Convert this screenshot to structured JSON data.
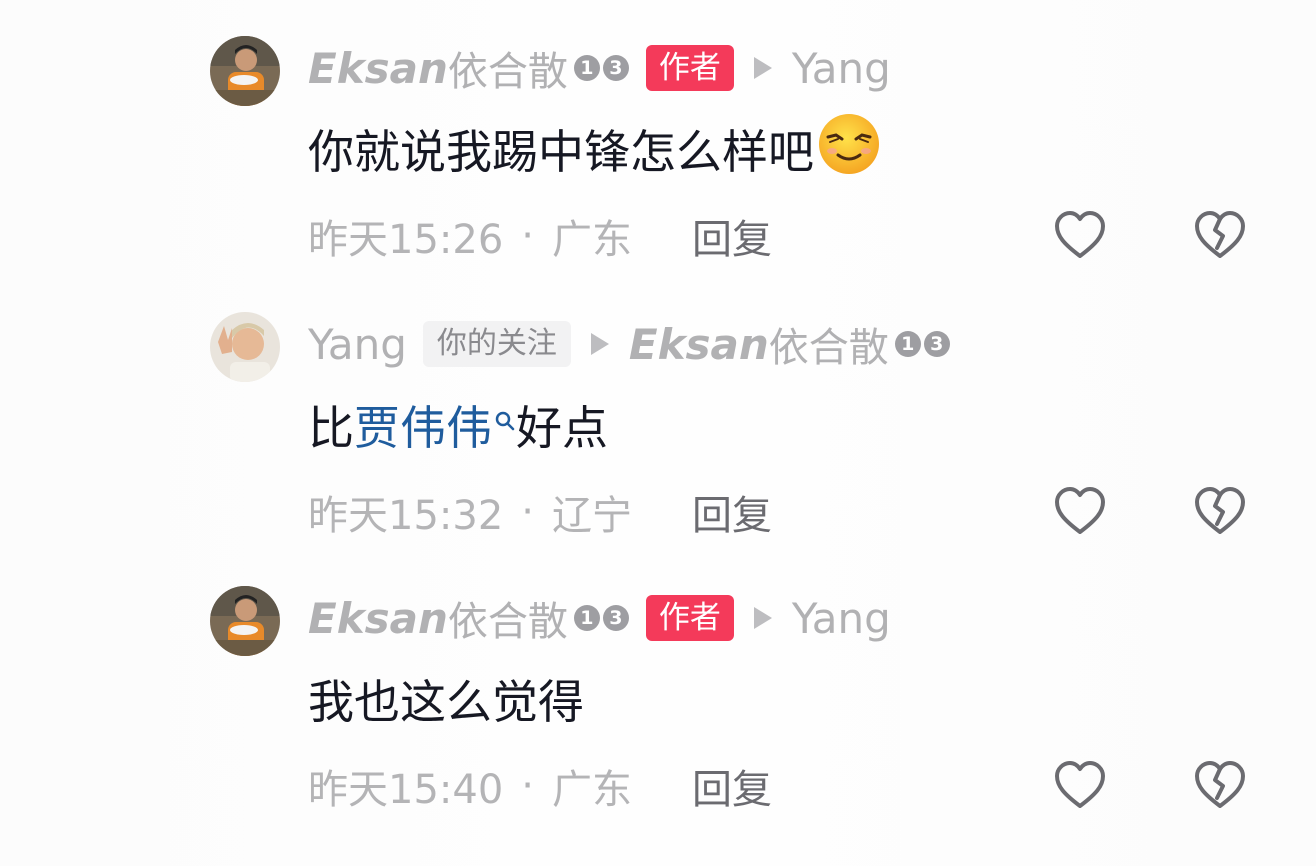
{
  "comments": [
    {
      "author_italic": "Eksan",
      "author_cn": "依合散",
      "level_digits": [
        "1",
        "3"
      ],
      "author_tag": "作者",
      "reply_to": "Yang",
      "text": "你就说我踢中锋怎么样吧",
      "emoji": "smiling-face-emoji",
      "time": "昨天15:26",
      "location": "广东",
      "reply_label": "回复"
    },
    {
      "author": "Yang",
      "follow_tag": "你的关注",
      "reply_to_italic": "Eksan",
      "reply_to_cn": "依合散",
      "level_digits": [
        "1",
        "3"
      ],
      "text_prefix": "比",
      "text_link": "贾伟伟",
      "text_suffix": "好点",
      "time": "昨天15:32",
      "location": "辽宁",
      "reply_label": "回复"
    },
    {
      "author_italic": "Eksan",
      "author_cn": "依合散",
      "level_digits": [
        "1",
        "3"
      ],
      "author_tag": "作者",
      "reply_to": "Yang",
      "text": "我也这么觉得",
      "time": "昨天15:40",
      "location": "广东",
      "reply_label": "回复"
    }
  ],
  "separator": "·",
  "colors": {
    "author_tag_bg": "#f43a5a",
    "link": "#1f5c9d",
    "muted": "#b1b1b3",
    "text": "#161823"
  },
  "icons": {
    "like": "heart-outline-icon",
    "dislike": "broken-heart-icon",
    "search": "search-icon",
    "arrow": "play-arrow-icon"
  }
}
